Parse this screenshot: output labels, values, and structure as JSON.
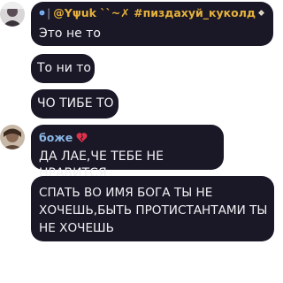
{
  "messages": [
    {
      "sender": "@Yψuk ``~✗ #пиздахуй_куколд",
      "sender_prefix_emoji": "blue-swirl-icon",
      "sender_suffix_emoji": "flower-icon",
      "text": "Это не то"
    },
    {
      "text": "То ни то"
    },
    {
      "text": "ЧО ТИБЕ ТО"
    },
    {
      "sender": "боже",
      "sender_suffix_emoji": "red-heart-icon",
      "text": "ДА ЛАЕ,ЧЕ ТЕБЕ НЕ НРАВИТСЯ"
    },
    {
      "text": "СПАТЬ ВО ИМЯ БОГА ТЫ НЕ ХОЧЕШЬ,БЫТЬ ПРОТИСТАНТАМИ ТЫ НЕ ХОЧЕШЬ"
    }
  ],
  "colors": {
    "bubble_bg": "#1a1726",
    "bubble_text": "#f1f1f4",
    "sender_1": "#e7b23c",
    "sender_2": "#8ab7e6",
    "heart": "#e0314b"
  }
}
